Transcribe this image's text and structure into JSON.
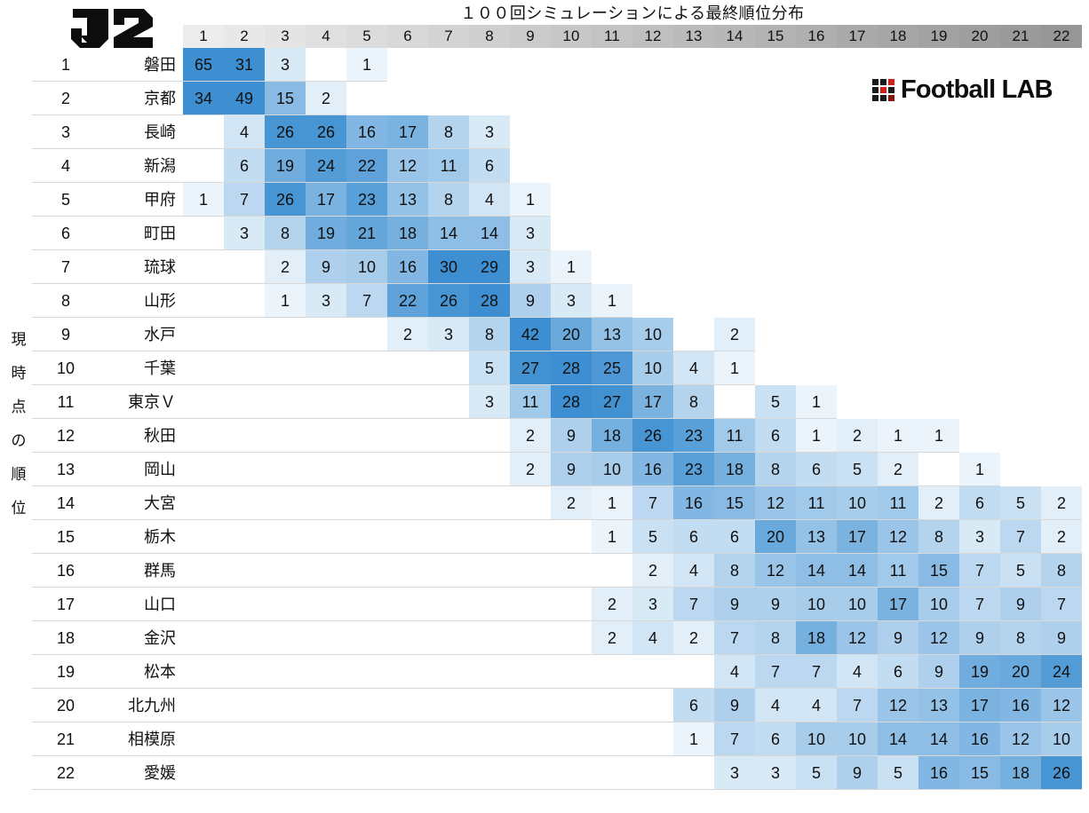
{
  "title": "１００回シミュレーションによる最終順位分布",
  "league_logo": "J2",
  "brand": {
    "name": "Football LAB",
    "logo_icon": "footballlab-grid-icon",
    "grid_colors": [
      "#1a1a1a",
      "#1a1a1a",
      "#d4201a",
      "#1a1a1a",
      "#d4201a",
      "#1a1a1a",
      "#1a1a1a",
      "#1a1a1a",
      "#8c1410"
    ]
  },
  "y_axis_caption": [
    "現",
    "時",
    "点",
    "の",
    "順",
    "位"
  ],
  "colors": {
    "accent_max": "#3d8fd1",
    "accent_min": "#f5fafd",
    "header_light": "#ececec",
    "header_dark": "#9a9a9a",
    "rule": "#d8d8d8",
    "text": "#111111"
  },
  "column_headers": [
    "1",
    "2",
    "3",
    "4",
    "5",
    "6",
    "7",
    "8",
    "9",
    "10",
    "11",
    "12",
    "13",
    "14",
    "15",
    "16",
    "17",
    "18",
    "19",
    "20",
    "21",
    "22"
  ],
  "chart_data": {
    "type": "heatmap",
    "title": "１００回シミュレーションによる最終順位分布",
    "xlabel": "最終順位",
    "ylabel": "現時点の順位",
    "legend": "none",
    "grid": false,
    "value_unit": "回（100回中）",
    "vmin": 0,
    "vmax": 65,
    "x_categories": [
      "1",
      "2",
      "3",
      "4",
      "5",
      "6",
      "7",
      "8",
      "9",
      "10",
      "11",
      "12",
      "13",
      "14",
      "15",
      "16",
      "17",
      "18",
      "19",
      "20",
      "21",
      "22"
    ],
    "y_categories": [
      "磐田",
      "京都",
      "長崎",
      "新潟",
      "甲府",
      "町田",
      "琉球",
      "山形",
      "水戸",
      "千葉",
      "東京Ｖ",
      "秋田",
      "岡山",
      "大宮",
      "栃木",
      "群馬",
      "山口",
      "金沢",
      "松本",
      "北九州",
      "相模原",
      "愛媛"
    ],
    "rows": [
      {
        "rank": "1",
        "team": "磐田",
        "values": [
          65,
          31,
          3,
          null,
          1,
          null,
          null,
          null,
          null,
          null,
          null,
          null,
          null,
          null,
          null,
          null,
          null,
          null,
          null,
          null,
          null,
          null
        ]
      },
      {
        "rank": "2",
        "team": "京都",
        "values": [
          34,
          49,
          15,
          2,
          null,
          null,
          null,
          null,
          null,
          null,
          null,
          null,
          null,
          null,
          null,
          null,
          null,
          null,
          null,
          null,
          null,
          null
        ]
      },
      {
        "rank": "3",
        "team": "長崎",
        "values": [
          null,
          4,
          26,
          26,
          16,
          17,
          8,
          3,
          null,
          null,
          null,
          null,
          null,
          null,
          null,
          null,
          null,
          null,
          null,
          null,
          null,
          null
        ]
      },
      {
        "rank": "4",
        "team": "新潟",
        "values": [
          null,
          6,
          19,
          24,
          22,
          12,
          11,
          6,
          null,
          null,
          null,
          null,
          null,
          null,
          null,
          null,
          null,
          null,
          null,
          null,
          null,
          null
        ]
      },
      {
        "rank": "5",
        "team": "甲府",
        "values": [
          1,
          7,
          26,
          17,
          23,
          13,
          8,
          4,
          1,
          null,
          null,
          null,
          null,
          null,
          null,
          null,
          null,
          null,
          null,
          null,
          null,
          null
        ]
      },
      {
        "rank": "6",
        "team": "町田",
        "values": [
          null,
          3,
          8,
          19,
          21,
          18,
          14,
          14,
          3,
          null,
          null,
          null,
          null,
          null,
          null,
          null,
          null,
          null,
          null,
          null,
          null,
          null
        ]
      },
      {
        "rank": "7",
        "team": "琉球",
        "values": [
          null,
          null,
          2,
          9,
          10,
          16,
          30,
          29,
          3,
          1,
          null,
          null,
          null,
          null,
          null,
          null,
          null,
          null,
          null,
          null,
          null,
          null
        ]
      },
      {
        "rank": "8",
        "team": "山形",
        "values": [
          null,
          null,
          1,
          3,
          7,
          22,
          26,
          28,
          9,
          3,
          1,
          null,
          null,
          null,
          null,
          null,
          null,
          null,
          null,
          null,
          null,
          null
        ]
      },
      {
        "rank": "9",
        "team": "水戸",
        "values": [
          null,
          null,
          null,
          null,
          null,
          2,
          3,
          8,
          42,
          20,
          13,
          10,
          null,
          2,
          null,
          null,
          null,
          null,
          null,
          null,
          null,
          null
        ]
      },
      {
        "rank": "10",
        "team": "千葉",
        "values": [
          null,
          null,
          null,
          null,
          null,
          null,
          null,
          5,
          27,
          28,
          25,
          10,
          4,
          1,
          null,
          null,
          null,
          null,
          null,
          null,
          null,
          null
        ]
      },
      {
        "rank": "11",
        "team": "東京Ｖ",
        "values": [
          null,
          null,
          null,
          null,
          null,
          null,
          null,
          3,
          11,
          28,
          27,
          17,
          8,
          null,
          5,
          1,
          null,
          null,
          null,
          null,
          null,
          null
        ]
      },
      {
        "rank": "12",
        "team": "秋田",
        "values": [
          null,
          null,
          null,
          null,
          null,
          null,
          null,
          null,
          2,
          9,
          18,
          26,
          23,
          11,
          6,
          1,
          2,
          1,
          1,
          null,
          null,
          null
        ]
      },
      {
        "rank": "13",
        "team": "岡山",
        "values": [
          null,
          null,
          null,
          null,
          null,
          null,
          null,
          null,
          2,
          9,
          10,
          16,
          23,
          18,
          8,
          6,
          5,
          2,
          null,
          1,
          null,
          null
        ]
      },
      {
        "rank": "14",
        "team": "大宮",
        "values": [
          null,
          null,
          null,
          null,
          null,
          null,
          null,
          null,
          null,
          2,
          1,
          7,
          16,
          15,
          12,
          11,
          10,
          11,
          2,
          6,
          5,
          2
        ]
      },
      {
        "rank": "15",
        "team": "栃木",
        "values": [
          null,
          null,
          null,
          null,
          null,
          null,
          null,
          null,
          null,
          null,
          1,
          5,
          6,
          6,
          20,
          13,
          17,
          12,
          8,
          3,
          7,
          2
        ]
      },
      {
        "rank": "16",
        "team": "群馬",
        "values": [
          null,
          null,
          null,
          null,
          null,
          null,
          null,
          null,
          null,
          null,
          null,
          2,
          4,
          8,
          12,
          14,
          14,
          11,
          15,
          7,
          5,
          8
        ]
      },
      {
        "rank": "17",
        "team": "山口",
        "values": [
          null,
          null,
          null,
          null,
          null,
          null,
          null,
          null,
          null,
          null,
          2,
          3,
          7,
          9,
          9,
          10,
          10,
          17,
          10,
          7,
          9,
          7
        ]
      },
      {
        "rank": "18",
        "team": "金沢",
        "values": [
          null,
          null,
          null,
          null,
          null,
          null,
          null,
          null,
          null,
          null,
          2,
          4,
          2,
          7,
          8,
          18,
          12,
          9,
          12,
          9,
          8,
          9
        ]
      },
      {
        "rank": "19",
        "team": "松本",
        "values": [
          null,
          null,
          null,
          null,
          null,
          null,
          null,
          null,
          null,
          null,
          null,
          null,
          null,
          4,
          7,
          7,
          4,
          6,
          9,
          19,
          20,
          24
        ]
      },
      {
        "rank": "20",
        "team": "北九州",
        "values": [
          null,
          null,
          null,
          null,
          null,
          null,
          null,
          null,
          null,
          null,
          null,
          null,
          6,
          9,
          4,
          4,
          7,
          12,
          13,
          17,
          16,
          12
        ]
      },
      {
        "rank": "21",
        "team": "相模原",
        "values": [
          null,
          null,
          null,
          null,
          null,
          null,
          null,
          null,
          null,
          null,
          null,
          null,
          1,
          7,
          6,
          10,
          10,
          14,
          14,
          16,
          12,
          10
        ]
      },
      {
        "rank": "22",
        "team": "愛媛",
        "values": [
          null,
          null,
          null,
          null,
          null,
          null,
          null,
          null,
          null,
          null,
          null,
          null,
          null,
          3,
          3,
          5,
          9,
          5,
          16,
          15,
          18,
          26
        ]
      }
    ]
  }
}
